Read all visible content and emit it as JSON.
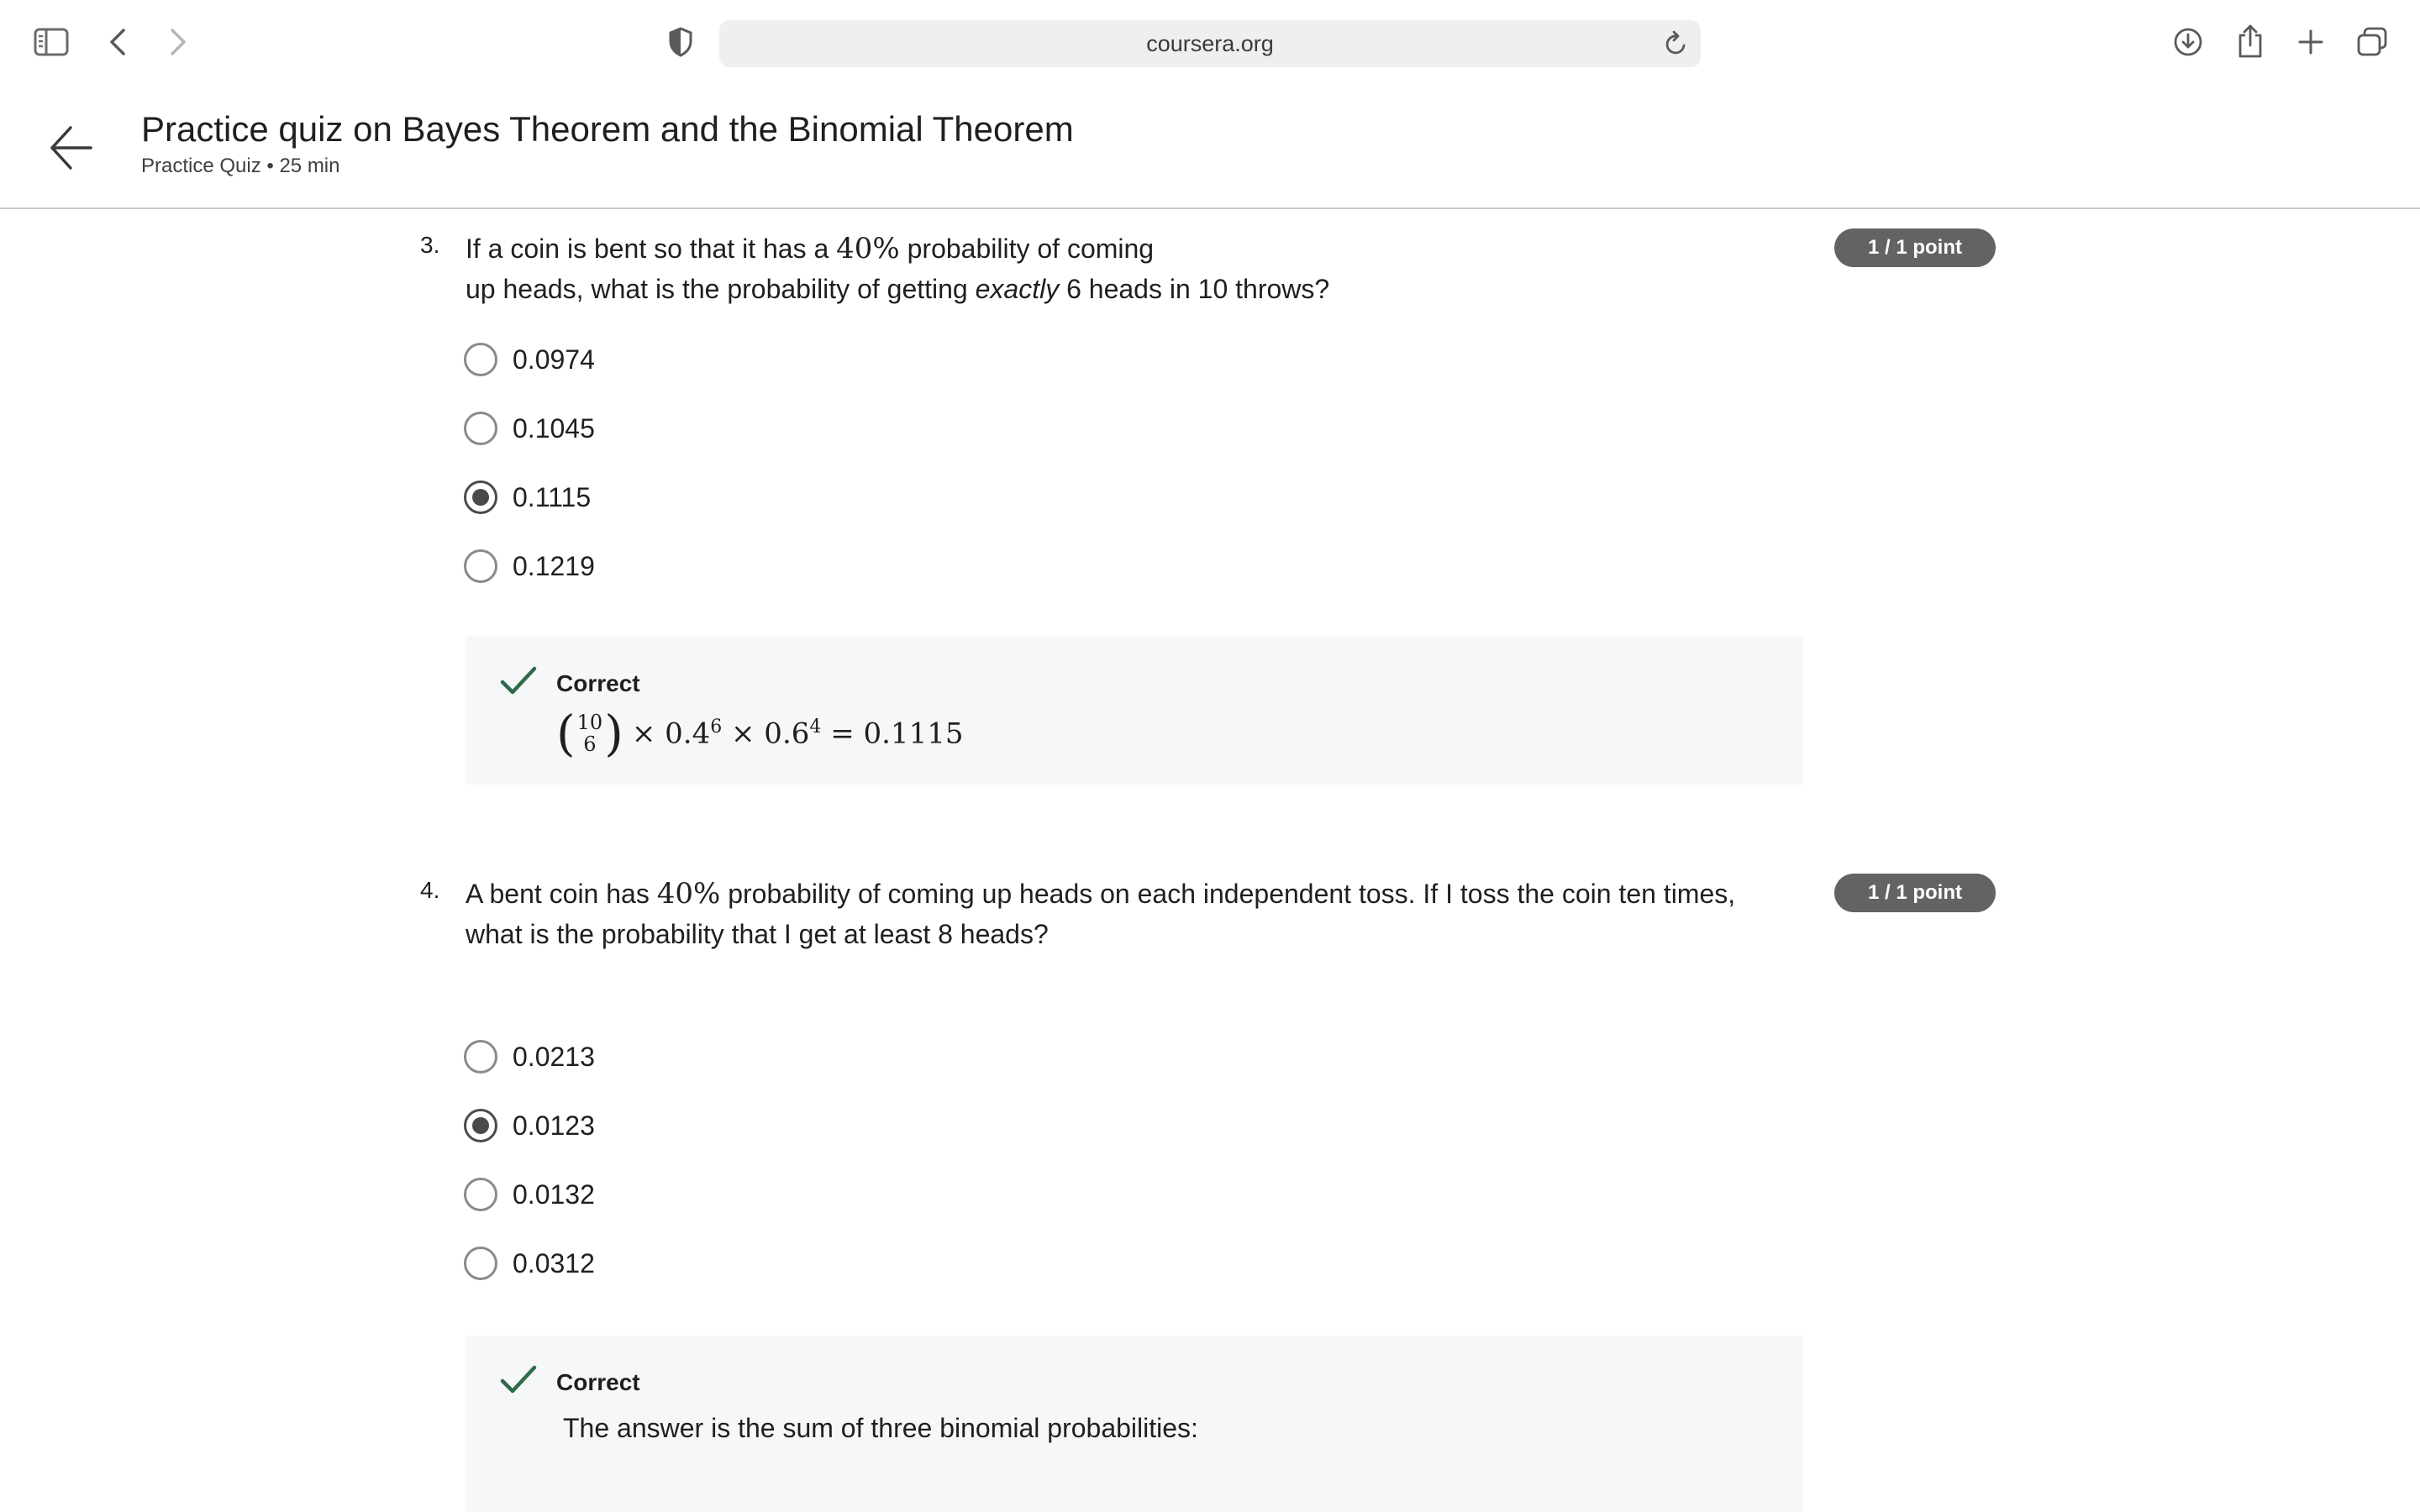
{
  "browser": {
    "url": "coursera.org"
  },
  "header": {
    "title": "Practice quiz on Bayes Theorem and the Binomial Theorem",
    "subtitle": "Practice Quiz • 25 min"
  },
  "questions": [
    {
      "number": "3.",
      "text_before": "If a coin is bent so that it has a ",
      "math": "40%",
      "text_line1_end": " probability of coming",
      "text_line2_a": "up heads, what is the probability of getting ",
      "text_emph": "exactly",
      "text_line2_b": " 6 heads in 10 throws?",
      "points": "1 / 1 point",
      "options": [
        {
          "label": "0.0974",
          "selected": false
        },
        {
          "label": "0.1045",
          "selected": false
        },
        {
          "label": "0.1115",
          "selected": true
        },
        {
          "label": "0.1219",
          "selected": false
        }
      ],
      "feedback": {
        "title": "Correct",
        "binom_top": "10",
        "binom_bottom": "6",
        "formula_rest_a": "× 0.4",
        "exp_a": "6",
        "formula_rest_b": " × 0.6",
        "exp_b": "4",
        "formula_result": " = 0.1115"
      }
    },
    {
      "number": "4.",
      "text_before": "A bent coin has ",
      "math": "40%",
      "text_line1_end": " probability of coming up heads on each independent toss. If I toss the coin ten times,",
      "text_line2": "what is the probability that I get at least 8 heads?",
      "points": "1 / 1 point",
      "options": [
        {
          "label": "0.0213",
          "selected": false
        },
        {
          "label": "0.0123",
          "selected": true
        },
        {
          "label": "0.0132",
          "selected": false
        },
        {
          "label": "0.0312",
          "selected": false
        }
      ],
      "feedback": {
        "title": "Correct",
        "body": "The answer is the sum of three binomial probabilities:"
      }
    }
  ],
  "icons": {
    "sidebar": "sidebar-icon",
    "back": "chevron-left-icon",
    "forward": "chevron-right-icon",
    "privacy": "shield-icon",
    "reload": "reload-icon",
    "download": "download-icon",
    "share": "share-icon",
    "new_tab": "plus-icon",
    "tabs": "tabs-overview-icon",
    "page_back": "arrow-left-icon",
    "correct": "checkmark-icon"
  },
  "colors": {
    "badge": "#636363",
    "check": "#2f6b4a",
    "feedback_bg": "#f5f7f8",
    "radio_selected": "#4a4a4a"
  }
}
